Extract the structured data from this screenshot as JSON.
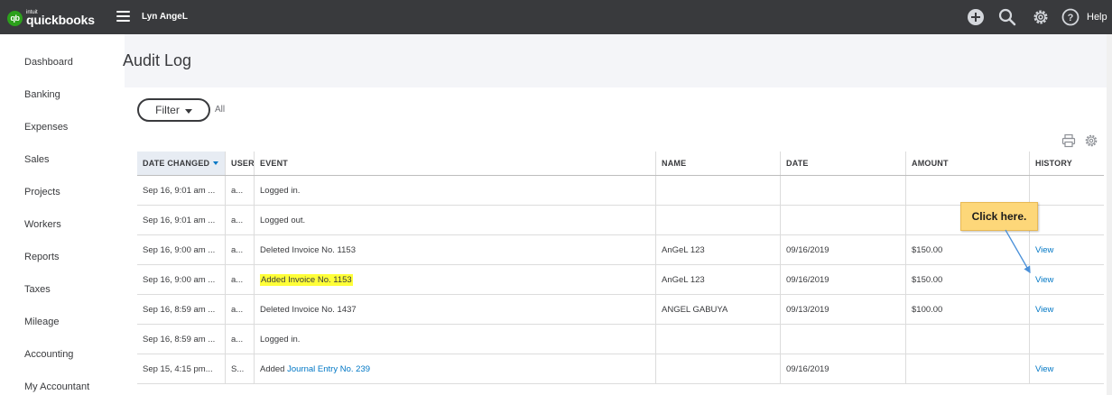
{
  "topbar": {
    "logo_badge": "qb",
    "logo_brand": "intuit",
    "logo_text": "quickbooks",
    "company": "Lyn AngeL",
    "help_label": "Help",
    "icons": [
      "plus-circle-icon",
      "search-icon",
      "gear-icon",
      "help-circle-icon"
    ]
  },
  "sidebar": {
    "items": [
      {
        "label": "Dashboard"
      },
      {
        "label": "Banking"
      },
      {
        "label": "Expenses"
      },
      {
        "label": "Sales"
      },
      {
        "label": "Projects"
      },
      {
        "label": "Workers"
      },
      {
        "label": "Reports"
      },
      {
        "label": "Taxes"
      },
      {
        "label": "Mileage"
      },
      {
        "label": "Accounting"
      },
      {
        "label": "My Accountant"
      }
    ]
  },
  "page": {
    "title": "Audit Log",
    "filter_label": "Filter",
    "filter_value": "All"
  },
  "table": {
    "headers": {
      "date_changed": "DATE CHANGED",
      "user": "USER",
      "event": "EVENT",
      "name": "NAME",
      "date": "DATE",
      "amount": "AMOUNT",
      "history": "HISTORY"
    },
    "rows": [
      {
        "date_changed": "Sep 16, 9:01 am ...",
        "user": "a...",
        "event": "Logged in.",
        "name": "",
        "date": "",
        "amount": "",
        "history": ""
      },
      {
        "date_changed": "Sep 16, 9:01 am ...",
        "user": "a...",
        "event": "Logged out.",
        "name": "",
        "date": "",
        "amount": "",
        "history": ""
      },
      {
        "date_changed": "Sep 16, 9:00 am ...",
        "user": "a...",
        "event": "Deleted Invoice No. 1153",
        "name": "AnGeL 123",
        "date": "09/16/2019",
        "amount": "$150.00",
        "history": "View"
      },
      {
        "date_changed": "Sep 16, 9:00 am ...",
        "user": "a...",
        "event": "Added Invoice No. 1153",
        "name": "AnGeL 123",
        "date": "09/16/2019",
        "amount": "$150.00",
        "history": "View"
      },
      {
        "date_changed": "Sep 16, 8:59 am ...",
        "user": "a...",
        "event": "Deleted Invoice No. 1437",
        "name": "ANGEL GABUYA",
        "date": "09/13/2019",
        "amount": "$100.00",
        "history": "View"
      },
      {
        "date_changed": "Sep 16, 8:59 am ...",
        "user": "a...",
        "event": "Logged in.",
        "name": "",
        "date": "",
        "amount": "",
        "history": ""
      },
      {
        "date_changed": "Sep 15, 4:15 pm...",
        "user": "S...",
        "event_prefix": "Added ",
        "event_link": "Journal Entry No. 239",
        "name": "",
        "date": "09/16/2019",
        "amount": "",
        "history": "View"
      }
    ]
  },
  "callout": {
    "text": "Click here.",
    "color": "#fdd779"
  },
  "colors": {
    "topbar": "#393a3d",
    "brand_green": "#2ca01c",
    "link": "#0077c5",
    "highlight": "#ffff38"
  }
}
